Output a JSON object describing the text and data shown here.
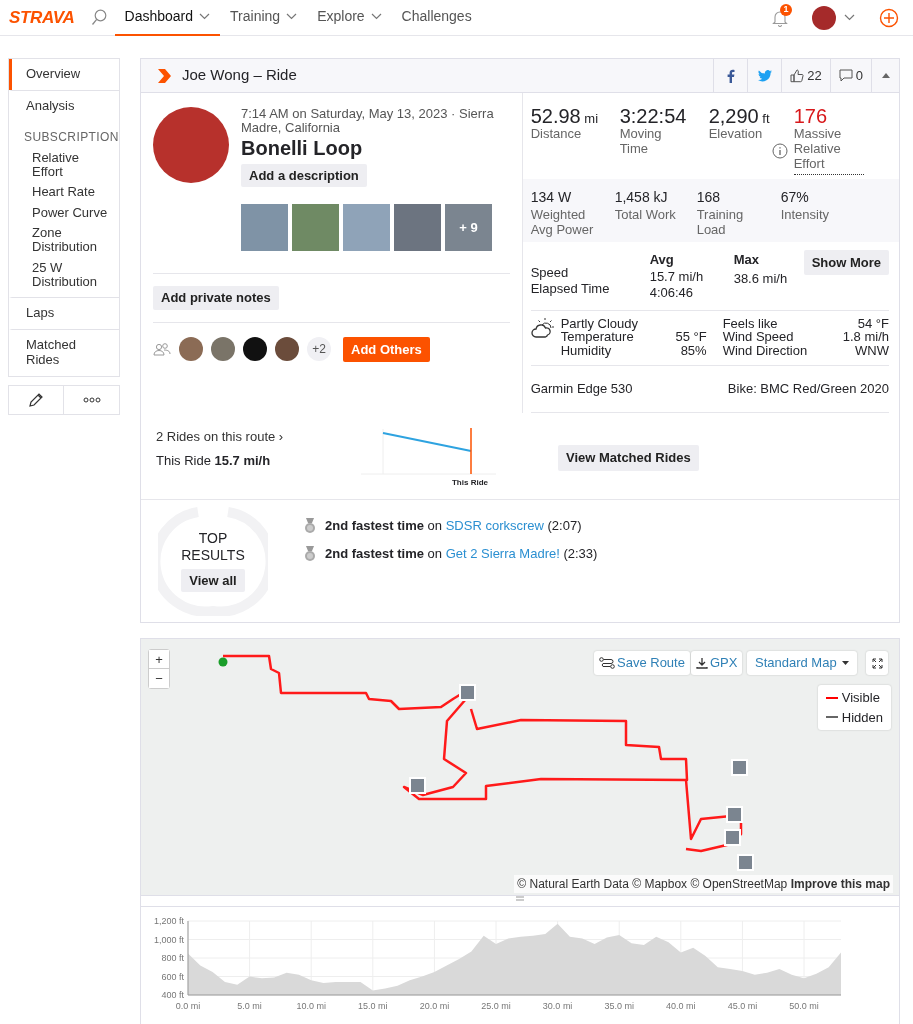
{
  "nav": {
    "logo": "STRAVA",
    "items": [
      {
        "label": "Dashboard",
        "selected": true,
        "dropdown": true
      },
      {
        "label": "Training",
        "selected": false,
        "dropdown": true
      },
      {
        "label": "Explore",
        "selected": false,
        "dropdown": true
      },
      {
        "label": "Challenges",
        "selected": false,
        "dropdown": false
      }
    ],
    "notification_count": "1"
  },
  "sidebar": {
    "items": [
      {
        "kind": "link",
        "label": "Overview",
        "selected": true
      },
      {
        "kind": "link",
        "label": "Analysis",
        "selected": false
      },
      {
        "kind": "heading",
        "label": "SUBSCRIPTION"
      },
      {
        "kind": "sublink",
        "label": "Relative Effort",
        "selected": false
      },
      {
        "kind": "sublink",
        "label": "Heart Rate",
        "selected": false
      },
      {
        "kind": "sublink",
        "label": "Power Curve",
        "selected": false
      },
      {
        "kind": "sublink",
        "label": "Zone Distribution",
        "selected": false
      },
      {
        "kind": "sublink",
        "label": "25 W Distribution",
        "selected": false
      },
      {
        "kind": "link",
        "label": "Laps",
        "selected": false
      },
      {
        "kind": "link",
        "label": "Matched Rides",
        "selected": false
      }
    ]
  },
  "activity": {
    "title": "Joe Wong – Ride",
    "kudos": "22",
    "comments": "0",
    "datetime_location": "7:14 AM on Saturday, May 13, 2023 · Sierra Madre, California",
    "name": "Bonelli Loop",
    "description_button": "Add a description",
    "photos_more": "+ 9",
    "private_notes_button": "Add private notes",
    "others_count": "+2",
    "add_others_button": "Add Others"
  },
  "primary_stats": [
    {
      "kind": "plain",
      "value": "52.98",
      "unit": "mi",
      "label": "Distance"
    },
    {
      "kind": "plain",
      "value": "3:22:54",
      "label": "Moving Time"
    },
    {
      "kind": "plain",
      "value": "2,290",
      "unit": "ft",
      "label": "Elevation"
    },
    {
      "kind": "effort",
      "value": "176",
      "label": "Massive Relative Effort"
    }
  ],
  "secondary_stats": [
    {
      "value": "134 W",
      "label": "Weighted Avg Power"
    },
    {
      "value": "1,458 kJ",
      "label": "Total Work"
    },
    {
      "value": "168",
      "label": "Training Load"
    },
    {
      "value": "67%",
      "label": "Intensity"
    }
  ],
  "speed_table": {
    "columns": [
      "Avg",
      "Max"
    ],
    "rows": [
      {
        "label": "Speed",
        "avg": "15.7 mi/h",
        "max": "38.6 mi/h"
      },
      {
        "label": "Elapsed Time",
        "avg": "4:06:46"
      }
    ],
    "show_more_button": "Show More"
  },
  "weather": {
    "condition": "Partly Cloudy",
    "left": [
      {
        "label": "Temperature",
        "value": "55 °F"
      },
      {
        "label": "Humidity",
        "value": "85%"
      }
    ],
    "right": [
      {
        "label": "Feels like",
        "value": "54 °F"
      },
      {
        "label": "Wind Speed",
        "value": "1.8 mi/h"
      },
      {
        "label": "Wind Direction",
        "value": "WNW"
      }
    ]
  },
  "device": "Garmin Edge 530",
  "bike": "Bike: BMC Red/Green 2020",
  "matched": {
    "link": "2 Rides on this route",
    "chevron": "›",
    "this_ride": "This Ride **15.7 mi/h**",
    "chart_label": "This Ride",
    "button": "View Matched Rides"
  },
  "top_results": {
    "title": "TOP RESULTS",
    "view_all": "View all",
    "results": [
      {
        "achievement": "**2nd fastest time** on",
        "segment": "SDSR corkscrew",
        "time": "(2:07)"
      },
      {
        "achievement": "**2nd fastest time** on",
        "segment": "Get 2 Sierra Madre!",
        "time": "(2:33)"
      }
    ]
  },
  "map": {
    "zoom_in": "+",
    "zoom_out": "−",
    "buttons": [
      "Save Route",
      "GPX"
    ],
    "style_select": "Standard Map",
    "legend": [
      {
        "label": "Visible",
        "color": "#ff0000"
      },
      {
        "label": "Hidden",
        "color": "#666666"
      }
    ],
    "attribution": "© Natural Earth Data © Mapbox © OpenStreetMap **Improve this map**"
  },
  "elevation": {
    "chart_data": {
      "type": "area",
      "grid": true,
      "x": [
        0,
        1,
        2,
        3,
        4,
        5,
        6,
        7,
        8,
        9,
        10,
        11,
        12,
        13,
        14,
        15,
        16,
        17,
        18,
        19,
        20,
        21,
        22,
        23,
        24,
        25,
        26,
        27,
        28,
        29,
        30,
        31,
        32,
        33,
        34,
        35,
        36,
        37,
        38,
        39,
        40,
        41,
        42,
        43,
        44,
        45,
        46,
        47,
        48,
        49,
        50,
        51,
        52,
        53
      ],
      "series": [
        {
          "color": "#d9d9d9",
          "values": [
            850,
            720,
            650,
            540,
            510,
            600,
            580,
            590,
            640,
            620,
            560,
            530,
            540,
            540,
            540,
            450,
            470,
            500,
            560,
            600,
            650,
            720,
            790,
            870,
            1040,
            950,
            1010,
            1030,
            1040,
            1060,
            1170,
            1030,
            1010,
            950,
            1020,
            1050,
            960,
            940,
            1030,
            970,
            860,
            910,
            820,
            700,
            680,
            660,
            620,
            640,
            680,
            620,
            580,
            630,
            700,
            860
          ]
        }
      ],
      "xlim": [
        0,
        53
      ],
      "ylim": [
        400,
        1200
      ],
      "xticks": [
        {
          "value": 0,
          "label": "0.0 mi"
        },
        {
          "value": 5,
          "label": "5.0 mi"
        },
        {
          "value": 10,
          "label": "10.0 mi"
        },
        {
          "value": 15,
          "label": "15.0 mi"
        },
        {
          "value": 20,
          "label": "20.0 mi"
        },
        {
          "value": 25,
          "label": "25.0 mi"
        },
        {
          "value": 30,
          "label": "30.0 mi"
        },
        {
          "value": 35,
          "label": "35.0 mi"
        },
        {
          "value": 40,
          "label": "40.0 mi"
        },
        {
          "value": 45,
          "label": "45.0 mi"
        },
        {
          "value": 50,
          "label": "50.0 mi"
        }
      ],
      "yticks": [
        {
          "value": 400,
          "label": "400 ft"
        },
        {
          "value": 600,
          "label": "600 ft"
        },
        {
          "value": 800,
          "label": "800 ft"
        },
        {
          "value": 1000,
          "label": "1,000 ft"
        },
        {
          "value": 1200,
          "label": "1,200 ft"
        }
      ]
    }
  }
}
